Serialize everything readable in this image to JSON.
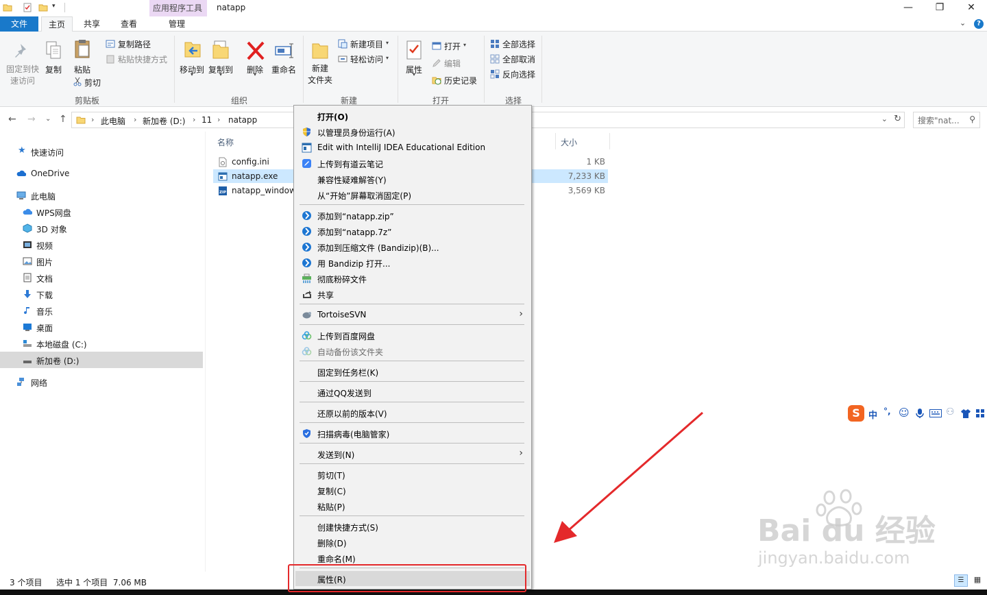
{
  "window": {
    "title": "natapp",
    "contextual_tab_title": "应用程序工具",
    "buttons": {
      "minimize": "—",
      "maximize": "❐",
      "close": "✕"
    },
    "help": "?"
  },
  "ribbon_tabs": [
    "文件",
    "主页",
    "共享",
    "查看",
    "管理"
  ],
  "ribbon": {
    "clipboard": {
      "pin": "固定到快\n速访问",
      "copy": "复制",
      "paste": "粘贴",
      "copy_path": "复制路径",
      "paste_shortcut": "粘贴快捷方式",
      "cut": "剪切",
      "group": "剪贴板"
    },
    "organize": {
      "move_to": "移动到",
      "copy_to": "复制到",
      "delete": "删除",
      "rename": "重命名",
      "group": "组织"
    },
    "new": {
      "new_folder": "新建\n文件夹",
      "new_item": "新建项目",
      "easy_access": "轻松访问",
      "group": "新建"
    },
    "open": {
      "properties": "属性",
      "open": "打开",
      "edit": "编辑",
      "history": "历史记录",
      "group": "打开"
    },
    "select": {
      "select_all": "全部选择",
      "select_none": "全部取消",
      "invert": "反向选择",
      "group": "选择"
    }
  },
  "address": {
    "crumbs": [
      "此电脑",
      "新加卷 (D:)",
      "11",
      "natapp"
    ],
    "search_placeholder": "搜索\"nat..."
  },
  "nav_pane": [
    {
      "label": "快速访问",
      "icon": "star-icon"
    },
    {
      "label": "OneDrive",
      "icon": "cloud-icon"
    },
    {
      "label": "此电脑",
      "icon": "computer-icon"
    },
    {
      "label": "WPS网盘",
      "icon": "wps-cloud-icon"
    },
    {
      "label": "3D 对象",
      "icon": "cube-icon"
    },
    {
      "label": "视频",
      "icon": "video-icon"
    },
    {
      "label": "图片",
      "icon": "picture-icon"
    },
    {
      "label": "文档",
      "icon": "document-icon"
    },
    {
      "label": "下载",
      "icon": "download-icon"
    },
    {
      "label": "音乐",
      "icon": "music-icon"
    },
    {
      "label": "桌面",
      "icon": "desktop-icon"
    },
    {
      "label": "本地磁盘 (C:)",
      "icon": "drive-icon"
    },
    {
      "label": "新加卷 (D:)",
      "icon": "drive-icon"
    },
    {
      "label": "网络",
      "icon": "network-icon"
    }
  ],
  "file_list": {
    "columns": {
      "name": "名称",
      "size": "大小"
    },
    "files": [
      {
        "name": "config.ini",
        "size": "1 KB",
        "icon": "ini-file-icon"
      },
      {
        "name": "natapp.exe",
        "size": "7,233 KB",
        "icon": "exe-file-icon"
      },
      {
        "name": "natapp_windows",
        "size": "3,569 KB",
        "icon": "zip-file-icon"
      }
    ]
  },
  "status": {
    "count": "3 个项目",
    "selected": "选中 1 个项目  7.06 MB"
  },
  "context_menu": {
    "items": [
      {
        "label": "打开(O)",
        "bold": true
      },
      {
        "label": "以管理员身份运行(A)",
        "icon": "shield-icon"
      },
      {
        "label": "Edit with IntelliJ IDEA Educational Edition",
        "icon": "intellij-icon"
      },
      {
        "label": "上传到有道云笔记",
        "icon": "youdao-icon"
      },
      {
        "label": "兼容性疑难解答(Y)"
      },
      {
        "label": "从“开始”屏幕取消固定(P)"
      },
      {
        "label": "添加到“natapp.zip”",
        "icon": "bandizip-icon"
      },
      {
        "label": "添加到“natapp.7z”",
        "icon": "bandizip-icon"
      },
      {
        "label": "添加到压缩文件 (Bandizip)(B)...",
        "icon": "bandizip-icon"
      },
      {
        "label": "用 Bandizip 打开...",
        "icon": "bandizip-icon"
      },
      {
        "label": "彻底粉碎文件",
        "icon": "shredder-icon"
      },
      {
        "label": "共享",
        "icon": "share-icon"
      },
      {
        "label": "TortoiseSVN",
        "icon": "tortoisesvn-icon"
      },
      {
        "label": "上传到百度网盘",
        "icon": "baidu-cloud-icon"
      },
      {
        "label": "自动备份该文件夹",
        "icon": "baidu-cloud-icon",
        "dim": true
      },
      {
        "label": "固定到任务栏(K)"
      },
      {
        "label": "通过QQ发送到"
      },
      {
        "label": "还原以前的版本(V)"
      },
      {
        "label": "扫描病毒(电脑管家)",
        "icon": "tencent-shield-icon"
      },
      {
        "label": "发送到(N)"
      },
      {
        "label": "剪切(T)"
      },
      {
        "label": "复制(C)"
      },
      {
        "label": "粘贴(P)"
      },
      {
        "label": "创建快捷方式(S)"
      },
      {
        "label": "删除(D)"
      },
      {
        "label": "重命名(M)"
      },
      {
        "label": "属性(R)"
      }
    ]
  },
  "ime_toolbar": {
    "mode": "中",
    "punct": "°,"
  },
  "watermark": {
    "brand": "Bai du 经验",
    "url": "jingyan.baidu.com"
  },
  "colors": {
    "accent": "#1979ca",
    "selection": "#cce8ff",
    "annotation": "#e4292b"
  }
}
